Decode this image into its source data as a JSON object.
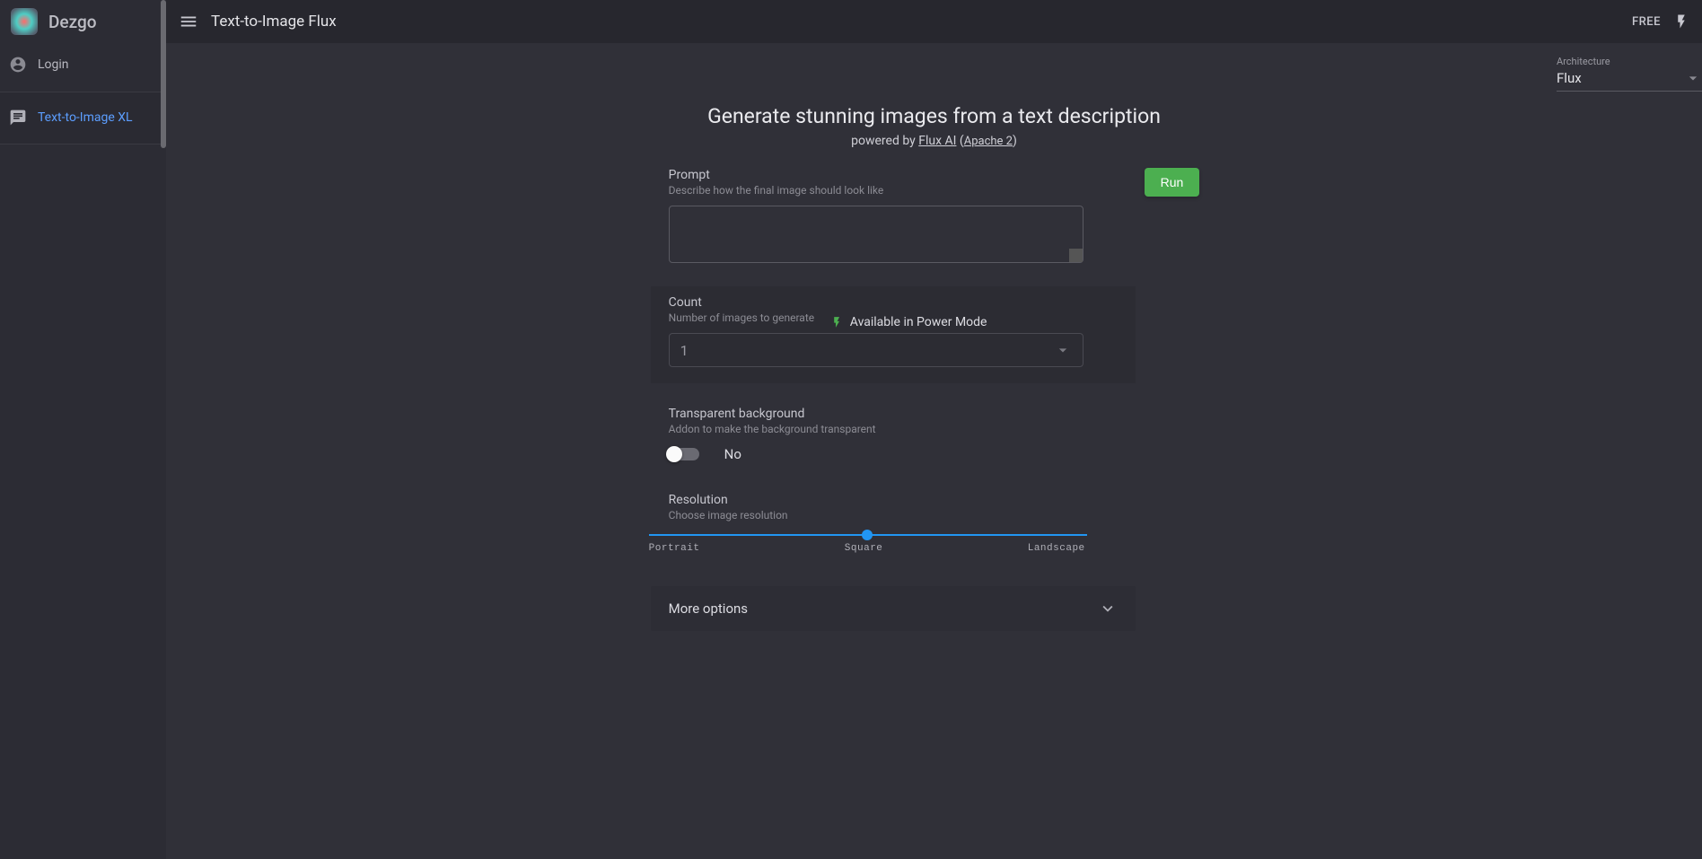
{
  "brand": "Dezgo",
  "sidebar": {
    "login": "Login",
    "items": [
      {
        "label": "Text-to-Image XL"
      }
    ]
  },
  "topbar": {
    "title": "Text-to-Image Flux",
    "free_badge": "FREE"
  },
  "architecture": {
    "label": "Architecture",
    "value": "Flux"
  },
  "hero": {
    "title": "Generate stunning images from a text description",
    "powered_prefix": "powered by ",
    "flux": "Flux AI",
    "license_open": " (",
    "license": "Apache 2",
    "license_close": ")"
  },
  "form": {
    "prompt": {
      "label": "Prompt",
      "help": "Describe how the final image should look like",
      "value": ""
    },
    "count": {
      "label": "Count",
      "help": "Number of images to generate",
      "value": "1",
      "power_mode": "Available in Power Mode"
    },
    "transparent": {
      "label": "Transparent background",
      "help": "Addon to make the background transparent",
      "value": "No"
    },
    "resolution": {
      "label": "Resolution",
      "help": "Choose image resolution",
      "labels": {
        "portrait": "Portrait",
        "square": "Square",
        "landscape": "Landscape"
      }
    },
    "more_options": "More options",
    "run": "Run"
  }
}
